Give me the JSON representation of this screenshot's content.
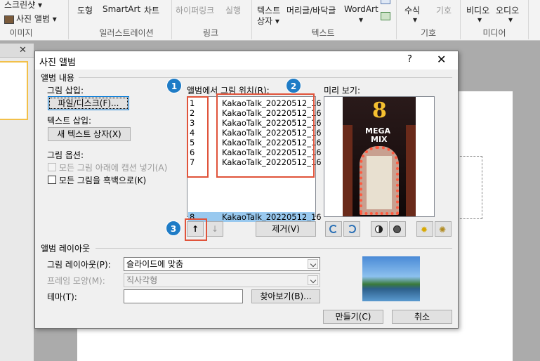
{
  "ribbon": {
    "items": {
      "screenshot": "스크린샷 ▾",
      "photo_album": "사진 앨범 ▾",
      "shapes": "도형",
      "smartart": "SmartArt",
      "chart": "차트",
      "hyperlink": "하이퍼링크",
      "action": "실행",
      "textbox": "텍스트",
      "textbox2": "상자 ▾",
      "header_footer": "머리글/바닥글",
      "wordart": "WordArt",
      "wordart_arrow": "▾",
      "equation": "수식",
      "equation_arrow": "▾",
      "symbol": "기호",
      "video": "비디오",
      "video_arrow": "▾",
      "audio": "오디오",
      "audio_arrow": "▾"
    },
    "groups": {
      "images": "이미지",
      "illustrations": "일러스트레이션",
      "links": "링크",
      "text": "텍스트",
      "symbols": "기호",
      "media": "미디어"
    }
  },
  "pane": {
    "close": "✕"
  },
  "dialog": {
    "title": "사진 앨범",
    "help": "?",
    "close": "✕",
    "album_content": "앨범 내용",
    "insert_picture_label": "그림 삽입:",
    "file_disk_button": "파일/디스크(F)...",
    "insert_text_label": "텍스트 삽입:",
    "new_textbox_button": "새 텍스트 상자(X)",
    "picture_options_label": "그림 옵션:",
    "captions_option": "모든 그림 아래에 캡션 넣기(A)",
    "bw_option": "모든 그림을 흑백으로(K)",
    "pictures_in_album_label": "앨범에서 그림 위치(R):",
    "pictures": [
      {
        "num": "1",
        "name": "KakaoTalk_20220512_16"
      },
      {
        "num": "2",
        "name": "KakaoTalk_20220512_16"
      },
      {
        "num": "3",
        "name": "KakaoTalk_20220512_16"
      },
      {
        "num": "4",
        "name": "KakaoTalk_20220512_16"
      },
      {
        "num": "5",
        "name": "KakaoTalk_20220512_16"
      },
      {
        "num": "6",
        "name": "KakaoTalk_20220512_16"
      },
      {
        "num": "7",
        "name": "KakaoTalk_20220512_16"
      },
      {
        "num": "8",
        "name": "KakaoTalk_20220512_16"
      }
    ],
    "selected_index": 8,
    "preview_label": "미리 보기:",
    "preview_sign": {
      "number": "8",
      "line1": "MEGA",
      "line2": "MIX"
    },
    "remove_button": "제거(V)",
    "move_up": "↑",
    "move_down": "↓",
    "album_layout": "앨범 레이아웃",
    "picture_layout_label": "그림 레이아웃(P):",
    "picture_layout_value": "슬라이드에 맞춤",
    "frame_shape_label": "프레임 모양(M):",
    "frame_shape_value": "직사각형",
    "theme_label": "테마(T):",
    "theme_value": "",
    "browse_button": "찾아보기(B)...",
    "create_button": "만들기(C)",
    "cancel_button": "취소",
    "badges": [
      "1",
      "2",
      "3"
    ]
  },
  "colors": {
    "annotation": "#e0533a",
    "badge": "#1f7cc6",
    "selection": "#99c9ef"
  }
}
